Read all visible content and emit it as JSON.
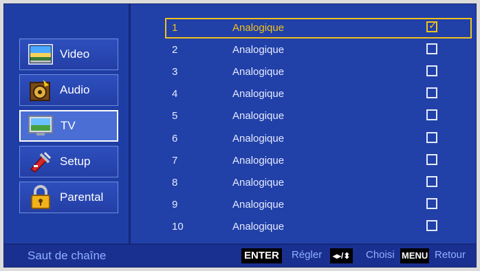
{
  "sidebar": {
    "items": [
      {
        "label": "Video",
        "icon": "video-icon"
      },
      {
        "label": "Audio",
        "icon": "audio-icon"
      },
      {
        "label": "TV",
        "icon": "tv-icon",
        "active": true
      },
      {
        "label": "Setup",
        "icon": "setup-icon"
      },
      {
        "label": "Parental",
        "icon": "parental-lock-icon"
      }
    ]
  },
  "channels": [
    {
      "num": "1",
      "type": "Analogique",
      "checked": true
    },
    {
      "num": "2",
      "type": "Analogique",
      "checked": false
    },
    {
      "num": "3",
      "type": "Analogique",
      "checked": false
    },
    {
      "num": "4",
      "type": "Analogique",
      "checked": false
    },
    {
      "num": "5",
      "type": "Analogique",
      "checked": false
    },
    {
      "num": "6",
      "type": "Analogique",
      "checked": false
    },
    {
      "num": "7",
      "type": "Analogique",
      "checked": false
    },
    {
      "num": "8",
      "type": "Analogique",
      "checked": false
    },
    {
      "num": "9",
      "type": "Analogique",
      "checked": false
    },
    {
      "num": "10",
      "type": "Analogique",
      "checked": false
    }
  ],
  "footer": {
    "title": "Saut de chaîne",
    "enter_key": "ENTER",
    "enter_action": "Régler",
    "arrows_key": "◂▸/⬍",
    "arrows_action": "Choisi",
    "menu_key": "MENU",
    "menu_action": "Retour"
  },
  "colors": {
    "background": "#2140a8",
    "highlight": "#f2c21a",
    "footer_text": "#8fb0ff"
  }
}
